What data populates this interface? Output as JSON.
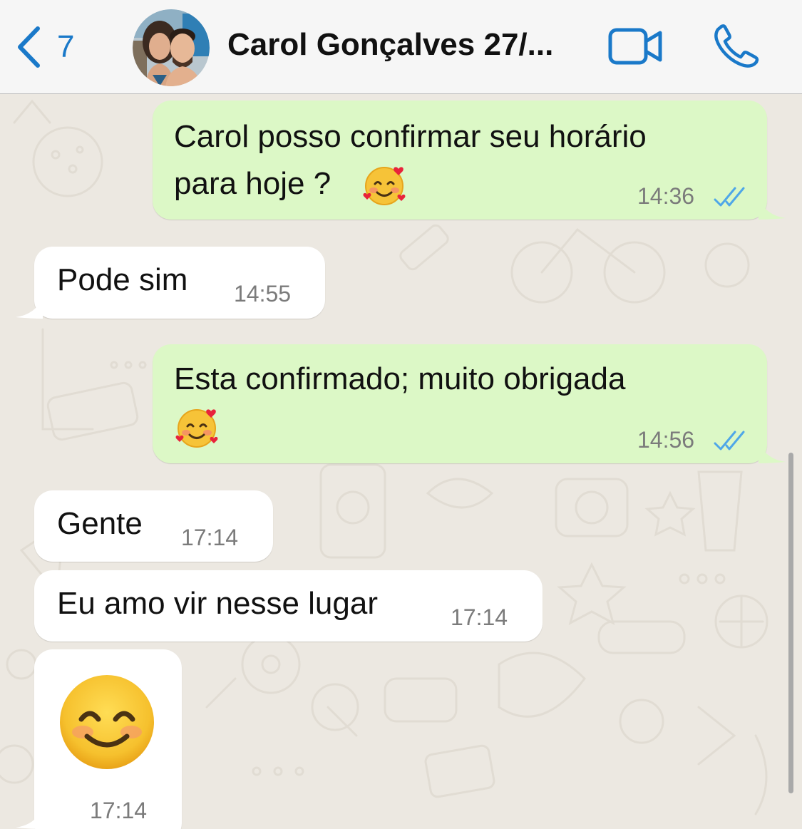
{
  "header": {
    "back_count": "7",
    "contact_name": "Carol Gonçalves  27/...",
    "back_icon": "chevron-left-icon",
    "video_icon": "video-camera-icon",
    "phone_icon": "phone-icon"
  },
  "colors": {
    "accent": "#1a79c9",
    "outgoing_bubble": "#dcf8c6",
    "incoming_bubble": "#ffffff",
    "read_checks": "#4fa7e8"
  },
  "messages": [
    {
      "direction": "out",
      "line1": "Carol posso confirmar seu horário",
      "line2": "para hoje ?",
      "emoji": "smiling-face-with-hearts-emoji",
      "time": "14:36",
      "status": "read"
    },
    {
      "direction": "in",
      "text": "Pode sim",
      "time": "14:55"
    },
    {
      "direction": "out",
      "line1": "Esta confirmado; muito obrigada",
      "emoji": "smiling-face-with-hearts-emoji",
      "time": "14:56",
      "status": "read"
    },
    {
      "direction": "in",
      "text": "Gente",
      "time": "17:14"
    },
    {
      "direction": "in",
      "text": "Eu amo vir nesse lugar",
      "time": "17:14"
    },
    {
      "direction": "in",
      "emoji": "smiling-face-with-smiling-eyes-emoji",
      "time": "17:14"
    }
  ]
}
